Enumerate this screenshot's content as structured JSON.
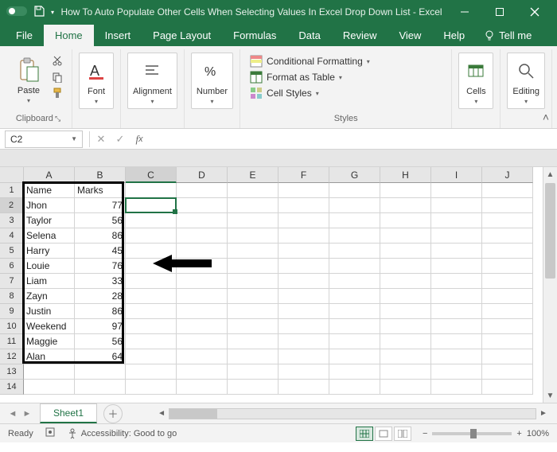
{
  "title": "How To Auto Populate Other Cells When Selecting Values In Excel Drop Down List  -  Excel",
  "tabs": {
    "file": "File",
    "home": "Home",
    "insert": "Insert",
    "page_layout": "Page Layout",
    "formulas": "Formulas",
    "data": "Data",
    "review": "Review",
    "view": "View",
    "help": "Help",
    "tell_me": "Tell me"
  },
  "ribbon": {
    "clipboard": {
      "label": "Clipboard",
      "paste": "Paste"
    },
    "font": {
      "label": "Font",
      "btn": "Font"
    },
    "alignment": {
      "label": "Alignment",
      "btn": "Alignment"
    },
    "number": {
      "label": "Number",
      "btn": "Number"
    },
    "styles": {
      "label": "Styles",
      "conditional": "Conditional Formatting",
      "table": "Format as Table",
      "cell": "Cell Styles"
    },
    "cells": {
      "label": "Cells",
      "btn": "Cells"
    },
    "editing": {
      "label": "Editing",
      "btn": "Editing"
    }
  },
  "namebox": "C2",
  "formula": "",
  "columns": [
    "A",
    "B",
    "C",
    "D",
    "E",
    "F",
    "G",
    "H",
    "I",
    "J"
  ],
  "row_count": 14,
  "selected_cell": {
    "col": 2,
    "row": 1
  },
  "selected_col_header": "C",
  "selected_row_header": "2",
  "data_rows": [
    {
      "a": "Name",
      "b": "Marks",
      "b_is_num": false
    },
    {
      "a": "Jhon",
      "b": "77",
      "b_is_num": true
    },
    {
      "a": "Taylor",
      "b": "56",
      "b_is_num": true
    },
    {
      "a": "Selena",
      "b": "86",
      "b_is_num": true
    },
    {
      "a": "Harry",
      "b": "45",
      "b_is_num": true
    },
    {
      "a": "Louie",
      "b": "76",
      "b_is_num": true
    },
    {
      "a": "Liam",
      "b": "33",
      "b_is_num": true
    },
    {
      "a": "Zayn",
      "b": "28",
      "b_is_num": true
    },
    {
      "a": "Justin",
      "b": "86",
      "b_is_num": true
    },
    {
      "a": "Weekend",
      "b": "97",
      "b_is_num": true
    },
    {
      "a": "Maggie",
      "b": "56",
      "b_is_num": true
    },
    {
      "a": "Alan",
      "b": "64",
      "b_is_num": true
    }
  ],
  "sheet": {
    "active": "Sheet1"
  },
  "status": {
    "ready": "Ready",
    "accessibility": "Accessibility: Good to go",
    "zoom": "100%"
  }
}
